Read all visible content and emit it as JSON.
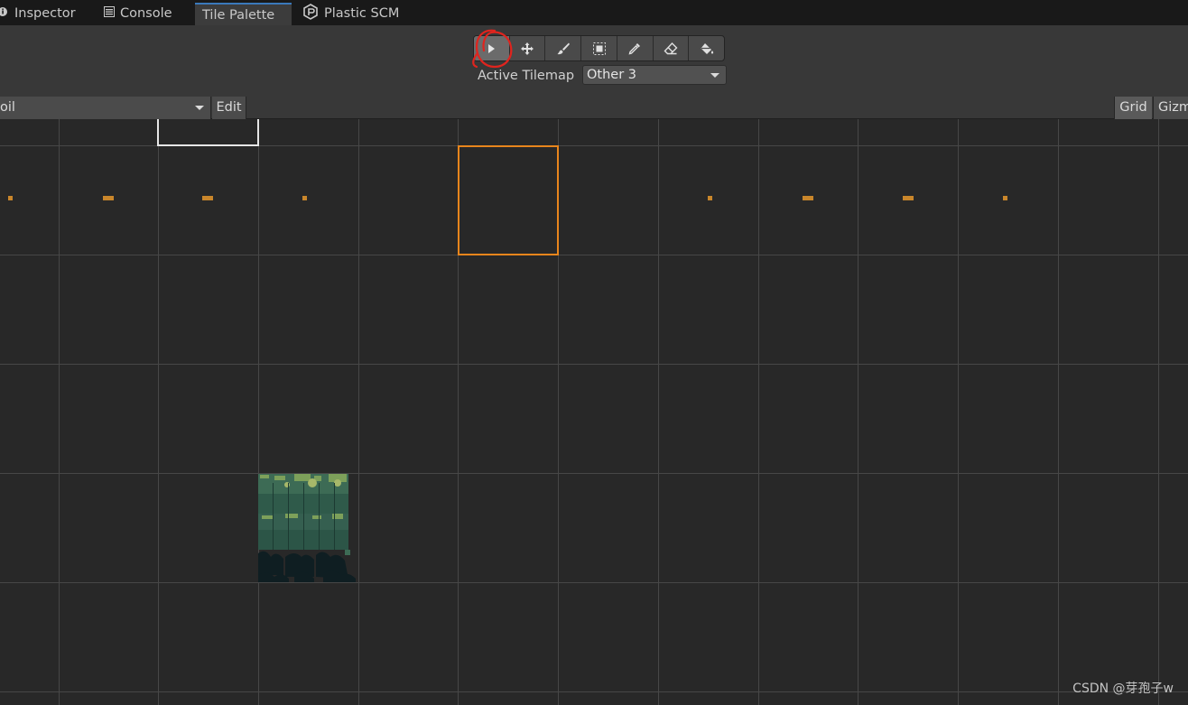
{
  "tabs": [
    {
      "label": "Inspector",
      "icon": "info-icon"
    },
    {
      "label": "Console",
      "icon": "console-icon"
    },
    {
      "label": "Tile Palette",
      "icon": "",
      "active": true
    },
    {
      "label": "Plastic SCM",
      "icon": "plastic-scm-icon"
    }
  ],
  "tools": [
    {
      "name": "select",
      "icon": "select-arrow-icon",
      "selected": true
    },
    {
      "name": "move",
      "icon": "move-icon"
    },
    {
      "name": "paint",
      "icon": "paintbrush-icon"
    },
    {
      "name": "box-fill",
      "icon": "box-fill-icon"
    },
    {
      "name": "pick",
      "icon": "eyedropper-icon"
    },
    {
      "name": "erase",
      "icon": "eraser-icon"
    },
    {
      "name": "flood-fill",
      "icon": "paint-bucket-icon"
    }
  ],
  "active_tilemap": {
    "label": "Active Tilemap",
    "value": "Other 3"
  },
  "palette_bar": {
    "palette_value": "oil",
    "edit_label": "Edit",
    "grid_label": "Grid",
    "gizmos_label": "Gizm"
  },
  "colors": {
    "accent_tab": "#3a79bb",
    "selection": "#e8851c",
    "tile": "#c9862b",
    "annotation": "#e0241e"
  },
  "watermark": "CSDN @芽孢子w"
}
